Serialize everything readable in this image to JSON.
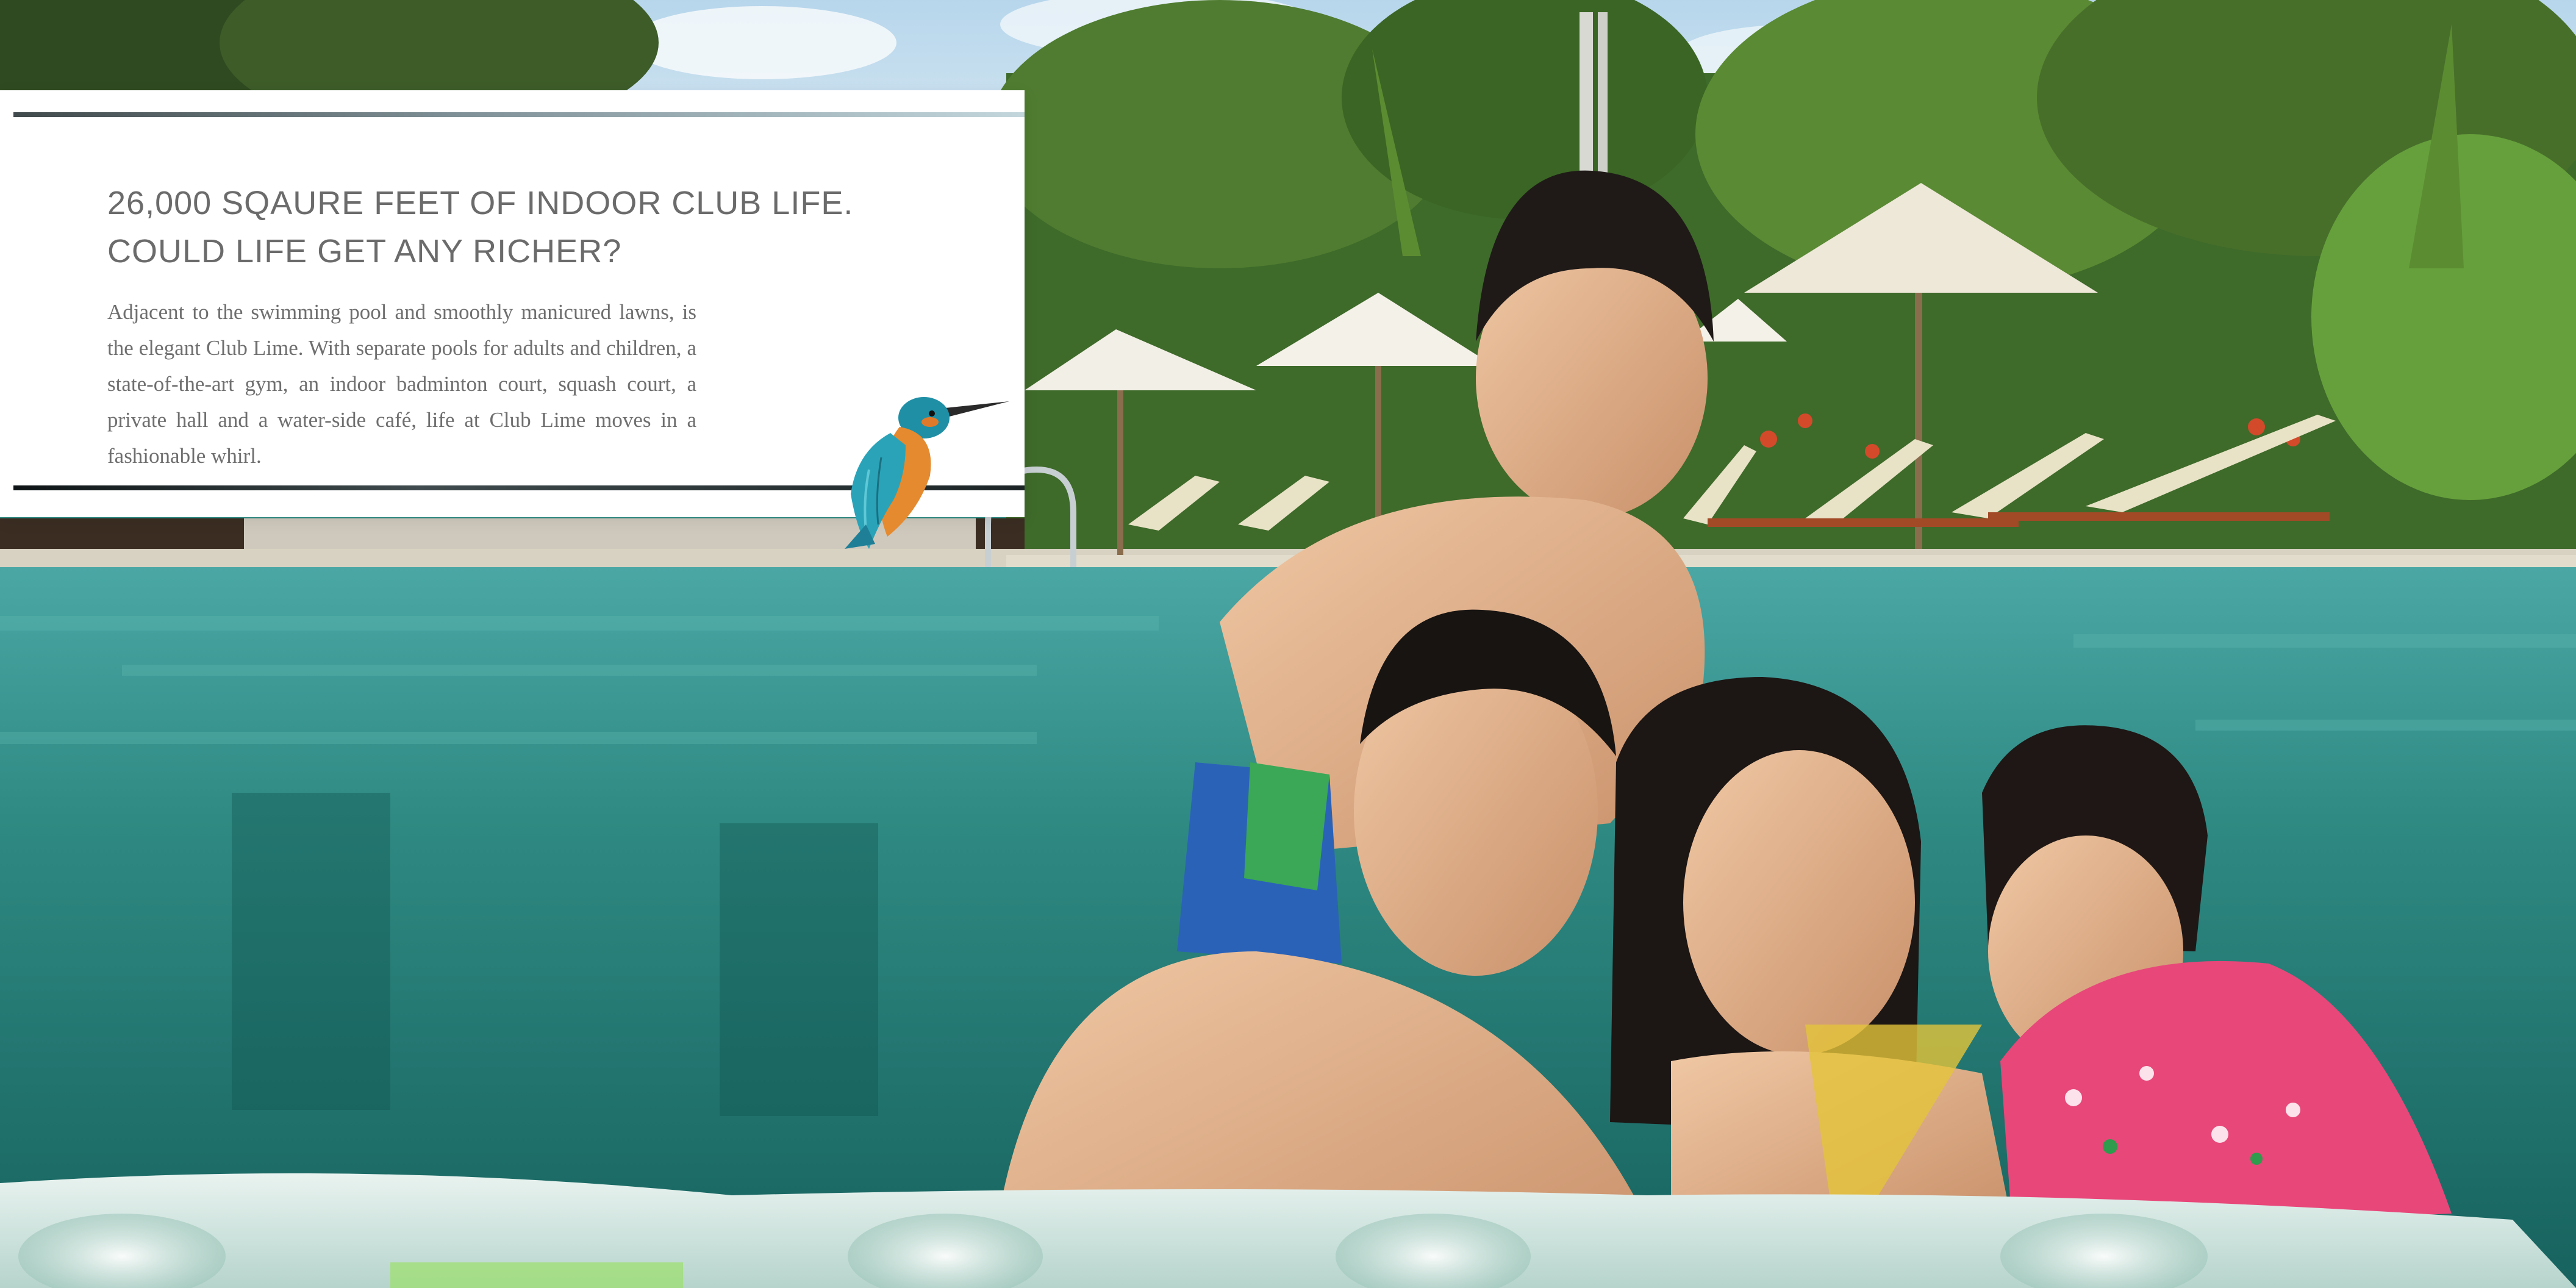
{
  "panel": {
    "headline_line1": "26,000 SQAURE FEET OF INDOOR CLUB LIFE.",
    "headline_line2": "COULD LIFE GET ANY RICHER?",
    "body": "Adjacent to the swimming pool and smoothly manicured lawns, is the elegant Club Lime. With separate pools for adults and children, a state-of-the-art gym, an indoor badminton court, squash court, a private hall and a water-side café, life at Club Lime moves in a fashionable whirl."
  },
  "colors": {
    "headline": "#6b6b6b",
    "body": "#6f6f6f",
    "pool_water": "#2f8f86",
    "panel_bg": "#ffffff"
  },
  "icons": {
    "bird": "kingfisher-illustration"
  }
}
